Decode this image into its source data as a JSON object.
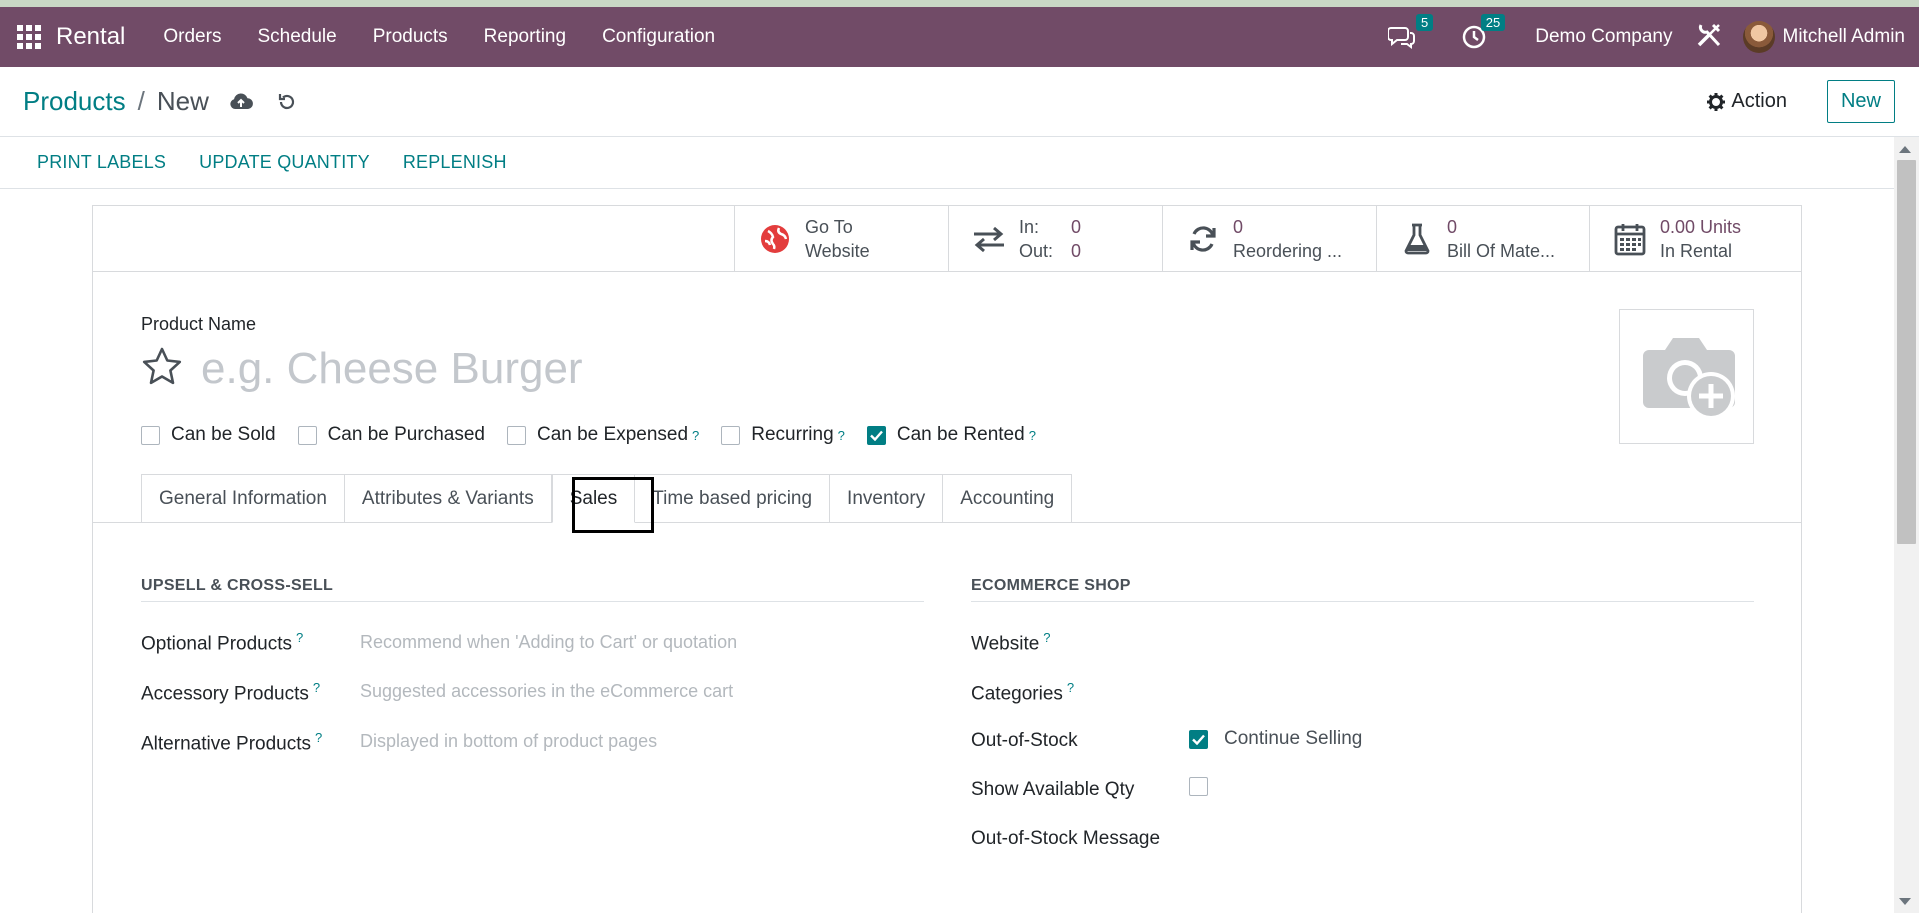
{
  "navbar": {
    "app_name": "Rental",
    "menu": [
      "Orders",
      "Schedule",
      "Products",
      "Reporting",
      "Configuration"
    ],
    "messages_count": "5",
    "activities_count": "25",
    "company": "Demo Company",
    "user": "Mitchell Admin",
    "bg_color": "#714b67"
  },
  "control": {
    "breadcrumb_parent": "Products",
    "breadcrumb_sep": "/",
    "breadcrumb_current": "New",
    "action_label": "Action",
    "new_label": "New"
  },
  "header_buttons": [
    "PRINT LABELS",
    "UPDATE QUANTITY",
    "REPLENISH"
  ],
  "smart_buttons": {
    "website": {
      "line1": "Go To",
      "line2": "Website"
    },
    "inout": {
      "in_label": "In:",
      "in_value": "0",
      "out_label": "Out:",
      "out_value": "0"
    },
    "reordering": {
      "value": "0",
      "label": "Reordering ..."
    },
    "bom": {
      "value": "0",
      "label": "Bill Of Mate..."
    },
    "rental": {
      "value": "0.00 Units",
      "label": "In Rental"
    }
  },
  "product": {
    "name_label": "Product Name",
    "name_placeholder": "e.g. Cheese Burger",
    "options": [
      {
        "label": "Can be Sold",
        "checked": false,
        "help": ""
      },
      {
        "label": "Can be Purchased",
        "checked": false,
        "help": ""
      },
      {
        "label": "Can be Expensed",
        "checked": false,
        "help": "?"
      },
      {
        "label": "Recurring",
        "checked": false,
        "help": "?"
      },
      {
        "label": "Can be Rented",
        "checked": true,
        "help": "?"
      }
    ]
  },
  "tabs": [
    "General Information",
    "Attributes & Variants",
    "Sales",
    "Time based pricing",
    "Inventory",
    "Accounting"
  ],
  "active_tab": "Sales",
  "upsell": {
    "title": "UPSELL & CROSS-SELL",
    "optional_label": "Optional Products",
    "optional_placeholder": "Recommend when 'Adding to Cart' or quotation",
    "accessory_label": "Accessory Products",
    "accessory_placeholder": "Suggested accessories in the eCommerce cart",
    "alternative_label": "Alternative Products",
    "alternative_placeholder": "Displayed in bottom of product pages",
    "help": "?"
  },
  "ecommerce": {
    "title": "ECOMMERCE SHOP",
    "website_label": "Website",
    "categories_label": "Categories",
    "oos_label": "Out-of-Stock",
    "continue_selling_label": "Continue Selling",
    "continue_selling_checked": true,
    "show_qty_label": "Show Available Qty",
    "show_qty_checked": false,
    "oos_message_label": "Out-of-Stock Message",
    "help": "?"
  },
  "colors": {
    "primary": "#714b67",
    "accent": "#017e84"
  }
}
